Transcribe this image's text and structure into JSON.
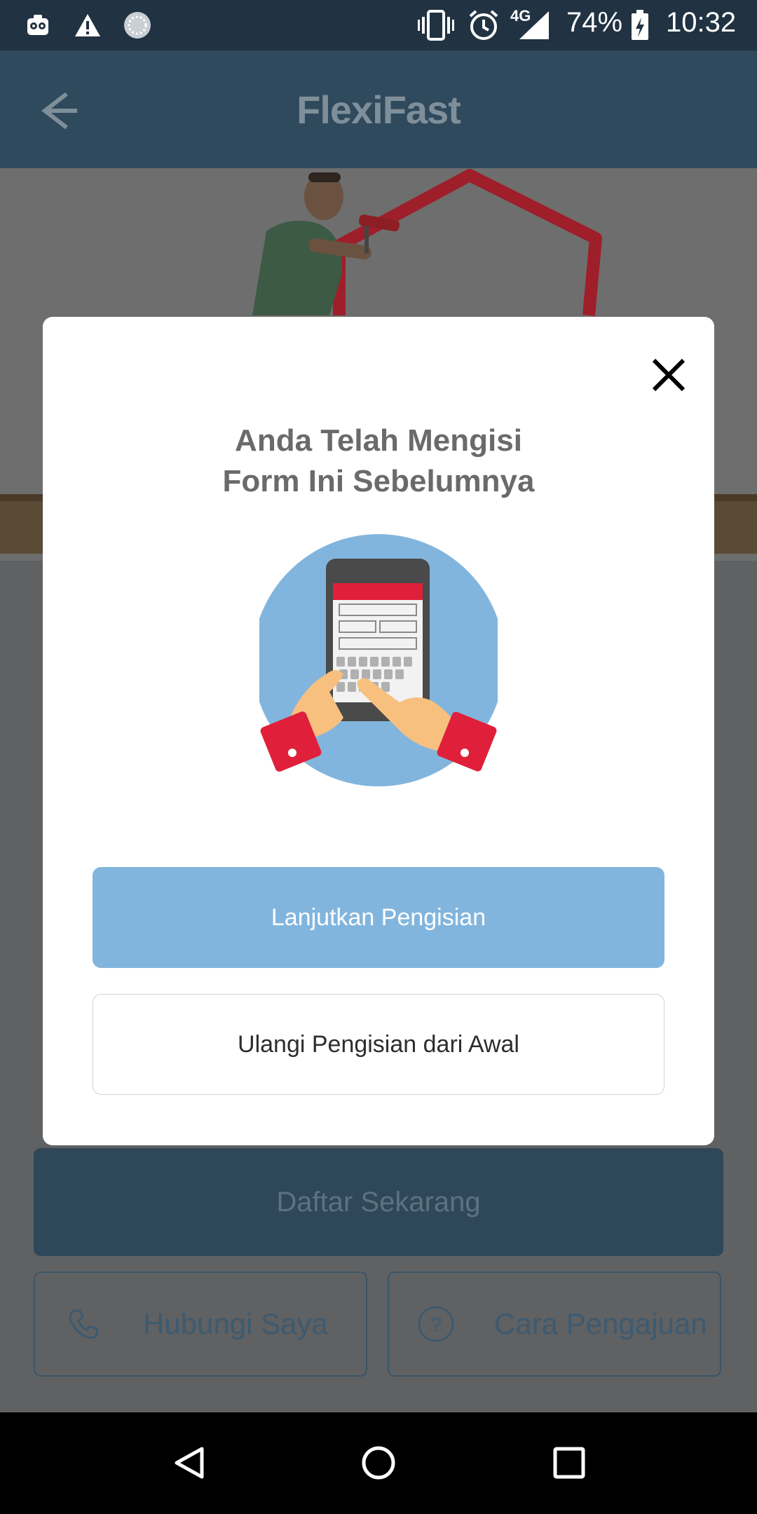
{
  "status_bar": {
    "battery": "74%",
    "time": "10:32",
    "network": "4G",
    "icons": [
      "lens-app-icon",
      "warning-icon",
      "loading-icon",
      "vibrate-icon",
      "alarm-icon",
      "signal-icon",
      "battery-charging-icon"
    ]
  },
  "app_bar": {
    "title": "FlexiFast",
    "back_icon": "back-arrow-icon"
  },
  "background_page": {
    "primary_button": "Daftar Sekarang",
    "contact_button": "Hubungi Saya",
    "howto_button": "Cara Pengajuan",
    "contact_icon": "phone-icon",
    "howto_icon": "question-circle-icon"
  },
  "modal": {
    "title_line1": "Anda Telah Mengisi",
    "title_line2": "Form Ini Sebelumnya",
    "continue_label": "Lanjutkan Pengisian",
    "restart_label": "Ulangi Pengisian dari Awal",
    "close_icon": "close-icon",
    "illustration": "phone-form-illustration"
  },
  "colors": {
    "status_bar": "#213242",
    "app_bar": "#2f495d",
    "continue_button": "#82b5dd",
    "accent_red": "#e0203a"
  }
}
